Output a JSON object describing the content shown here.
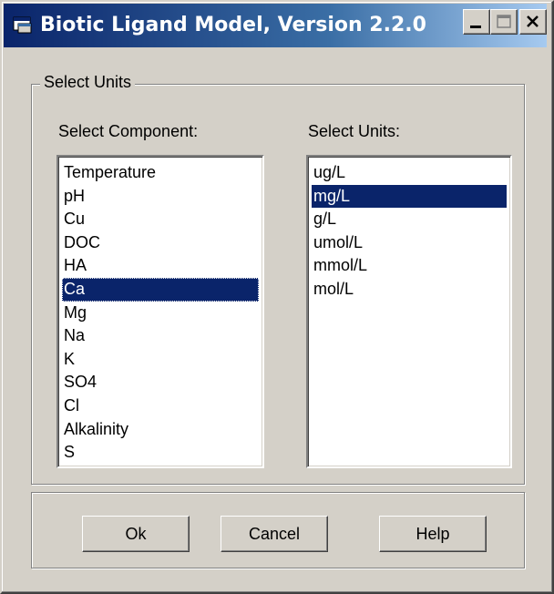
{
  "window": {
    "title": "Biotic Ligand Model, Version 2.2.0"
  },
  "group": {
    "legend": "Select Units"
  },
  "component_list": {
    "label": "Select Component:",
    "items": [
      "Temperature",
      "pH",
      "Cu",
      "DOC",
      "HA",
      "Ca",
      "Mg",
      "Na",
      "K",
      "SO4",
      "Cl",
      "Alkalinity",
      "S"
    ],
    "selected": "Ca"
  },
  "units_list": {
    "label": "Select Units:",
    "items": [
      "ug/L",
      "mg/L",
      "g/L",
      "umol/L",
      "mmol/L",
      "mol/L"
    ],
    "selected": "mg/L"
  },
  "buttons": {
    "ok": "Ok",
    "cancel": "Cancel",
    "help": "Help"
  },
  "colors": {
    "face": "#d4d0c8",
    "title_active": "#0a246a",
    "selection": "#0a246a"
  },
  "icons": {
    "app": "app-window-icon",
    "minimize": "minimize-icon",
    "maximize": "maximize-icon",
    "close": "close-icon"
  }
}
